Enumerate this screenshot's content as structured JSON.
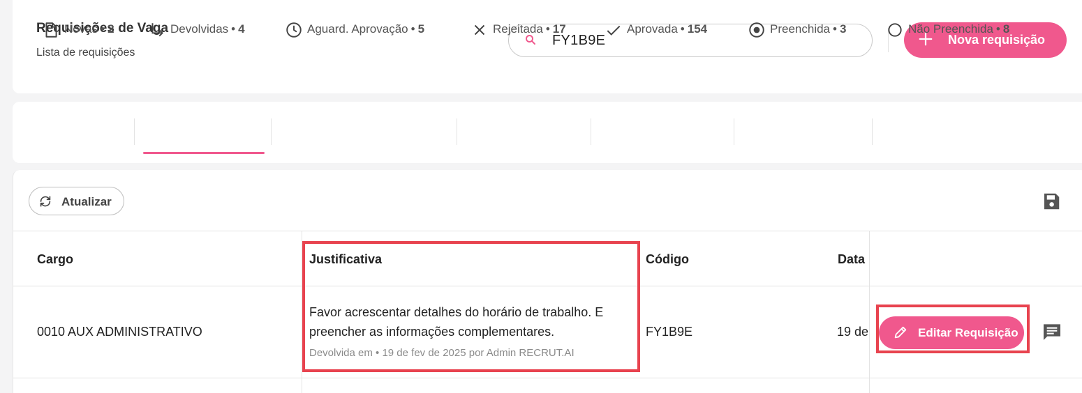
{
  "header": {
    "title": "Requisições de Vaga",
    "subtitle": "Lista de requisições",
    "search_value": "FY1B9E",
    "new_button_label": "Nova requisição"
  },
  "tabs": [
    {
      "label": "Novas",
      "count": "2",
      "icon": "document-icon"
    },
    {
      "label": "Devolvidas",
      "count": "4",
      "icon": "return-arrow-icon",
      "active": true
    },
    {
      "label": "Aguard. Aprovação",
      "count": "5",
      "icon": "clock-icon"
    },
    {
      "label": "Rejeitada",
      "count": "17",
      "icon": "close-icon"
    },
    {
      "label": "Aprovada",
      "count": "154",
      "icon": "check-icon"
    },
    {
      "label": "Preenchida",
      "count": "3",
      "icon": "radio-filled-icon"
    },
    {
      "label": "Não Preenchida",
      "count": "8",
      "icon": "radio-empty-icon"
    }
  ],
  "tab_separator": "•",
  "toolbar": {
    "refresh_label": "Atualizar"
  },
  "table": {
    "columns": [
      "Cargo",
      "Justificativa",
      "Código",
      "Data"
    ],
    "rows": [
      {
        "cargo": "0010 AUX ADMINISTRATIVO",
        "justificativa": "Favor acrescentar detalhes do horário de trabalho. E preencher as informações complementares.",
        "justificativa_meta": "Devolvida em • 19 de fev de 2025 por Admin RECRUT.AI",
        "codigo": "FY1B9E",
        "data": "19 de",
        "edit_label": "Editar Requisição"
      }
    ]
  },
  "colors": {
    "accent": "#f0588d",
    "highlight": "#e8434f"
  }
}
